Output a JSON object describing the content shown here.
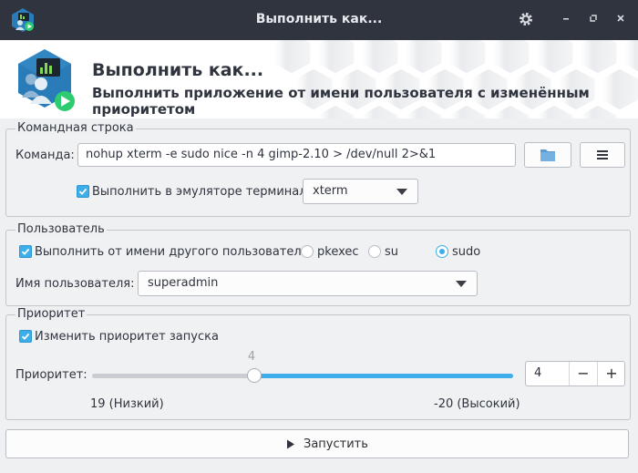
{
  "window": {
    "title": "Выполнить как...",
    "controls": {
      "settings_icon": "gear-icon",
      "minimize_icon": "minimize-icon",
      "maximize_icon": "maximize-icon",
      "close_icon": "close-icon"
    }
  },
  "header": {
    "title": "Выполнить как...",
    "subtitle": "Выполнить приложение от имени пользователя с изменённым приоритетом",
    "icon": "run-as-app-icon"
  },
  "command_group": {
    "title": "Командная строка",
    "command_label": "Команда:",
    "command_value": "nohup xterm -e sudo nice -n 4 gimp-2.10  > /dev/null 2>&1",
    "browse_icon": "folder-icon",
    "menu_icon": "hamburger-menu-icon",
    "terminal_checkbox_label": "Выполнить в эмуляторе терминала",
    "terminal_checked": true,
    "terminal_selected": "xterm"
  },
  "user_group": {
    "title": "Пользователь",
    "other_user_label": "Выполнить от имени другого пользователя:",
    "other_user_checked": true,
    "methods": [
      {
        "label": "pkexec",
        "checked": false
      },
      {
        "label": "su",
        "checked": false
      },
      {
        "label": "sudo",
        "checked": true
      }
    ],
    "username_label": "Имя пользователя:",
    "username_selected": "superadmin"
  },
  "priority_group": {
    "title": "Приоритет",
    "change_priority_label": "Изменить приоритет запуска",
    "change_priority_checked": true,
    "priority_label": "Приоритет:",
    "slider_value_text": "4",
    "slider_min_label": "19 (Низкий)",
    "slider_max_label": "-20 (Высокий)",
    "slider_min": 19,
    "slider_max": -20,
    "slider_value": 4,
    "spin_value": "4",
    "minus_label": "−",
    "plus_label": "+"
  },
  "run_button": {
    "label": "Запустить",
    "icon": "play-icon"
  },
  "colors": {
    "accent": "#3daee9",
    "titlebar": "#2f343f"
  }
}
